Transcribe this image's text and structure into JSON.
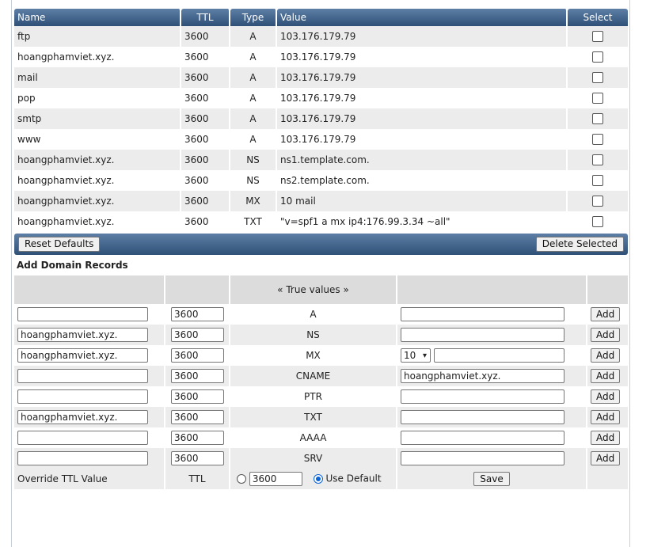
{
  "records_table": {
    "headers": {
      "name": "Name",
      "ttl": "TTL",
      "type": "Type",
      "value": "Value",
      "select": "Select"
    },
    "rows": [
      {
        "name": "ftp",
        "ttl": "3600",
        "type": "A",
        "value": "103.176.179.79",
        "checked": false
      },
      {
        "name": "hoangphamviet.xyz.",
        "ttl": "3600",
        "type": "A",
        "value": "103.176.179.79",
        "checked": false
      },
      {
        "name": "mail",
        "ttl": "3600",
        "type": "A",
        "value": "103.176.179.79",
        "checked": false
      },
      {
        "name": "pop",
        "ttl": "3600",
        "type": "A",
        "value": "103.176.179.79",
        "checked": false
      },
      {
        "name": "smtp",
        "ttl": "3600",
        "type": "A",
        "value": "103.176.179.79",
        "checked": false
      },
      {
        "name": "www",
        "ttl": "3600",
        "type": "A",
        "value": "103.176.179.79",
        "checked": false
      },
      {
        "name": "hoangphamviet.xyz.",
        "ttl": "3600",
        "type": "NS",
        "value": "ns1.template.com.",
        "checked": false
      },
      {
        "name": "hoangphamviet.xyz.",
        "ttl": "3600",
        "type": "NS",
        "value": "ns2.template.com.",
        "checked": false
      },
      {
        "name": "hoangphamviet.xyz.",
        "ttl": "3600",
        "type": "MX",
        "value": "10 mail",
        "checked": false
      },
      {
        "name": "hoangphamviet.xyz.",
        "ttl": "3600",
        "type": "TXT",
        "value": "\"v=spf1 a mx ip4:176.99.3.34 ~all\"",
        "checked": false
      }
    ],
    "reset_label": "Reset Defaults",
    "delete_label": "Delete Selected"
  },
  "add_section": {
    "title": "Add Domain Records",
    "true_values_label": "« True values »",
    "add_label": "Add",
    "rows": [
      {
        "name": "",
        "ttl": "3600",
        "type": "A",
        "value": ""
      },
      {
        "name": "hoangphamviet.xyz.",
        "ttl": "3600",
        "type": "NS",
        "value": ""
      },
      {
        "name": "hoangphamviet.xyz.",
        "ttl": "3600",
        "type": "MX",
        "priority": "10",
        "value": ""
      },
      {
        "name": "",
        "ttl": "3600",
        "type": "CNAME",
        "value": "hoangphamviet.xyz."
      },
      {
        "name": "",
        "ttl": "3600",
        "type": "PTR",
        "value": ""
      },
      {
        "name": "hoangphamviet.xyz.",
        "ttl": "3600",
        "type": "TXT",
        "value": ""
      },
      {
        "name": "",
        "ttl": "3600",
        "type": "AAAA",
        "value": ""
      },
      {
        "name": "",
        "ttl": "3600",
        "type": "SRV",
        "value": ""
      }
    ],
    "override": {
      "label": "Override TTL Value",
      "ttl_label": "TTL",
      "ttl_value": "3600",
      "use_default_label": "Use Default",
      "use_default_selected": true,
      "save_label": "Save"
    }
  }
}
